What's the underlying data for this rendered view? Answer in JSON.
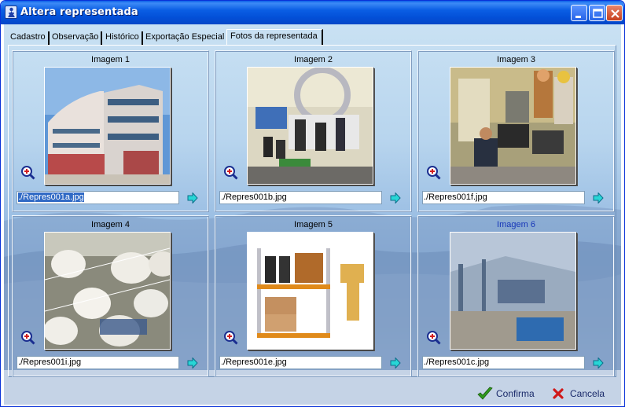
{
  "window": {
    "title": "Altera representada"
  },
  "tabs": [
    {
      "label": "Cadastro"
    },
    {
      "label": "Observação"
    },
    {
      "label": "Histórico"
    },
    {
      "label": "Exportação Especial"
    },
    {
      "label": "Fotos da representada"
    }
  ],
  "images": [
    {
      "label": "Imagem 1",
      "file": "./Repres001a.jpg",
      "subject": "office building"
    },
    {
      "label": "Imagem 2",
      "file": "./Repres001b.jpg",
      "subject": "exhibition stand"
    },
    {
      "label": "Imagem 3",
      "file": "./Repres001f.jpg",
      "subject": "factory control room"
    },
    {
      "label": "Imagem 4",
      "file": "./Repres001i.jpg",
      "subject": "textile yarn spools"
    },
    {
      "label": "Imagem 5",
      "file": "./Repres001e.jpg",
      "subject": "pallet rack"
    },
    {
      "label": "Imagem 6",
      "file": "./Repres001c.jpg",
      "subject": "warehouse interior"
    }
  ],
  "footer": {
    "confirm_label": "Confirma",
    "cancel_label": "Cancela"
  },
  "icons": {
    "zoom": "magnifier-plus-icon",
    "arrow": "arrow-right-icon",
    "confirm": "checkmark-icon",
    "cancel": "x-icon"
  },
  "colors": {
    "titlebar": "#0a5ee4",
    "selection": "#316ac5",
    "active_label": "#1737b8"
  }
}
